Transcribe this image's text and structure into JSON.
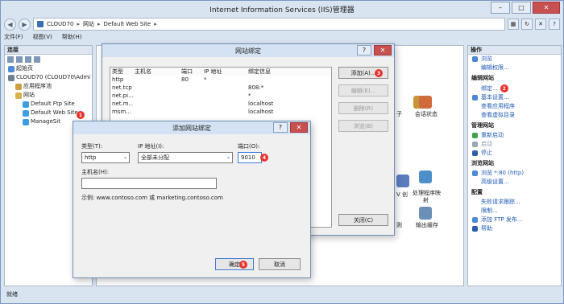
{
  "window": {
    "title": "Internet Information Services (IIS)管理器"
  },
  "address": {
    "crumbs": [
      "CLOUD70",
      "网站",
      "Default Web Site"
    ]
  },
  "menu": [
    "文件(F)",
    "视图(V)",
    "帮助(H)"
  ],
  "left": {
    "header": "连接",
    "tree": [
      {
        "label": "起始页",
        "color": "#4c8ad4",
        "indent": 0
      },
      {
        "label": "CLOUD70 (CLOUD70\\Admi",
        "color": "#6f7f95",
        "indent": 0
      },
      {
        "label": "应用程序池",
        "color": "#c8a040",
        "indent": 1
      },
      {
        "label": "网站",
        "color": "#d7b34a",
        "indent": 1
      },
      {
        "label": "Default Ftp Site",
        "color": "#3b9de0",
        "indent": 2
      },
      {
        "label": "Default Web Site",
        "color": "#3b9de0",
        "indent": 2
      },
      {
        "label": "ManageSit",
        "color": "#3b9de0",
        "indent": 2
      }
    ]
  },
  "mid": {
    "icons": [
      "子",
      "会话状态",
      "V 创",
      "处理程序映",
      "射",
      "则",
      "输出缓存"
    ]
  },
  "right": {
    "header": "操作",
    "items": [
      {
        "type": "link",
        "text": "浏览",
        "icon": "#4c8ad4"
      },
      {
        "type": "link",
        "text": "编辑权限..."
      },
      {
        "type": "section",
        "text": "编辑网站"
      },
      {
        "type": "link",
        "text": "绑定...",
        "marker": "2"
      },
      {
        "type": "link",
        "text": "基本设置...",
        "icon": "#4c8ad4"
      },
      {
        "type": "link",
        "text": "查看应用程序"
      },
      {
        "type": "link",
        "text": "查看虚拟目录"
      },
      {
        "type": "section",
        "text": "管理网站"
      },
      {
        "type": "link",
        "text": "重新启动",
        "icon": "#3fa34d"
      },
      {
        "type": "dis",
        "text": "启动",
        "icon": "#9aa5b3"
      },
      {
        "type": "link",
        "text": "停止",
        "icon": "#2c5fa8"
      },
      {
        "type": "section",
        "text": "浏览网站"
      },
      {
        "type": "link",
        "text": "浏览 *:80 (http)",
        "icon": "#4c8ad4"
      },
      {
        "type": "link",
        "text": "高级设置..."
      },
      {
        "type": "section",
        "text": "配置"
      },
      {
        "type": "link",
        "text": "失败请求跟踪..."
      },
      {
        "type": "link",
        "text": "限制..."
      },
      {
        "type": "link",
        "text": "添加 FTP 发布...",
        "icon": "#4c8ad4"
      },
      {
        "type": "link",
        "text": "帮助",
        "icon": "#2c5fa8"
      }
    ]
  },
  "status": "就绪",
  "bindings_dialog": {
    "title": "网站绑定",
    "columns": [
      "类型",
      "主机名",
      "端口",
      "IP 地址",
      "绑定信息"
    ],
    "rows": [
      [
        "http",
        "",
        "80",
        "*",
        ""
      ],
      [
        "net.tcp",
        "",
        "",
        "",
        "808:*"
      ],
      [
        "net.pi...",
        "",
        "",
        "",
        "*"
      ],
      [
        "net.m...",
        "",
        "",
        "",
        "localhost"
      ],
      [
        "msm...",
        "",
        "",
        "",
        "localhost"
      ]
    ],
    "buttons": {
      "add": "添加(A)...",
      "edit": "编辑(E)...",
      "remove": "删除(R)",
      "browse": "浏览(B)",
      "close": "关闭(C)"
    },
    "add_marker": "3"
  },
  "add_dialog": {
    "title": "添加网站绑定",
    "type_label": "类型(T):",
    "type_value": "http",
    "ip_label": "IP 地址(I):",
    "ip_value": "全部未分配",
    "port_label": "端口(O):",
    "port_value": "9010",
    "port_marker": "4",
    "host_label": "主机名(H):",
    "host_value": "",
    "example": "示例: www.contoso.com 或 marketing.contoso.com",
    "ok": "确定",
    "ok_marker": "5",
    "cancel": "取消"
  },
  "tree_marker": "1"
}
